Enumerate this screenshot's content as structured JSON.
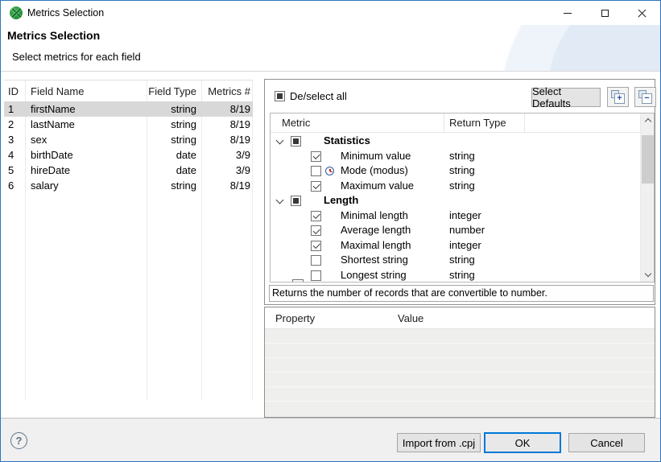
{
  "window": {
    "title": "Metrics Selection"
  },
  "header": {
    "title": "Metrics Selection",
    "subtitle": "Select metrics for each field"
  },
  "fields_table": {
    "columns": [
      "ID",
      "Field Name",
      "Field Type",
      "Metrics #"
    ],
    "rows": [
      {
        "id": "1",
        "name": "firstName",
        "type": "string",
        "metrics": "8/19",
        "selected": true
      },
      {
        "id": "2",
        "name": "lastName",
        "type": "string",
        "metrics": "8/19",
        "selected": false
      },
      {
        "id": "3",
        "name": "sex",
        "type": "string",
        "metrics": "8/19",
        "selected": false
      },
      {
        "id": "4",
        "name": "birthDate",
        "type": "date",
        "metrics": "3/9",
        "selected": false
      },
      {
        "id": "5",
        "name": "hireDate",
        "type": "date",
        "metrics": "3/9",
        "selected": false
      },
      {
        "id": "6",
        "name": "salary",
        "type": "string",
        "metrics": "8/19",
        "selected": false
      }
    ]
  },
  "metrics_panel": {
    "deselect_all": "De/select all",
    "select_defaults": "Select Defaults",
    "expand_all_glyph": "+",
    "collapse_all_glyph": "−",
    "columns": [
      "Metric",
      "Return Type"
    ],
    "groups": [
      {
        "label": "Statistics",
        "state": "partial",
        "children": [
          {
            "label": "Minimum value",
            "checked": true,
            "return_type": "string"
          },
          {
            "label": "Mode (modus)",
            "checked": false,
            "return_type": "string",
            "icon": "clock-icon"
          },
          {
            "label": "Maximum value",
            "checked": true,
            "return_type": "string"
          }
        ]
      },
      {
        "label": "Length",
        "state": "partial",
        "children": [
          {
            "label": "Minimal length",
            "checked": true,
            "return_type": "integer"
          },
          {
            "label": "Average length",
            "checked": true,
            "return_type": "number"
          },
          {
            "label": "Maximal length",
            "checked": true,
            "return_type": "integer"
          },
          {
            "label": "Shortest string",
            "checked": false,
            "return_type": "string"
          },
          {
            "label": "Longest string",
            "checked": false,
            "return_type": "string"
          }
        ]
      }
    ],
    "status_text": "Returns the number of records that are convertible to number."
  },
  "property_table": {
    "columns": [
      "Property",
      "Value"
    ],
    "empty_row_count": 5
  },
  "footer": {
    "help_glyph": "?",
    "import_label": "Import from .cpj",
    "ok_label": "OK",
    "cancel_label": "Cancel"
  },
  "colors": {
    "accent": "#0078d7",
    "window_border": "#2f76bd",
    "selected_row": "#d8d8d8"
  }
}
